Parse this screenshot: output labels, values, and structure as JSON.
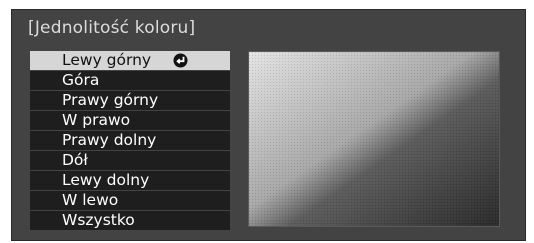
{
  "dialog": {
    "title": "[Jednolitość koloru]"
  },
  "menu": {
    "items": [
      {
        "label": "Lewy górny",
        "selected": true
      },
      {
        "label": "Góra"
      },
      {
        "label": "Prawy górny"
      },
      {
        "label": "W prawo"
      },
      {
        "label": "Prawy dolny"
      },
      {
        "label": "Dół"
      },
      {
        "label": "Lewy dolny"
      },
      {
        "label": "W lewo"
      },
      {
        "label": "Wszystko"
      }
    ],
    "selected_icon": "enter-icon"
  },
  "preview": {
    "light_color": "#e3e3e3",
    "dark_color": "#2a2a2a"
  },
  "colors": {
    "panel_bg": "#434344",
    "item_bg": "#1e1e1e",
    "selected_bg": "#d6d6d6"
  }
}
